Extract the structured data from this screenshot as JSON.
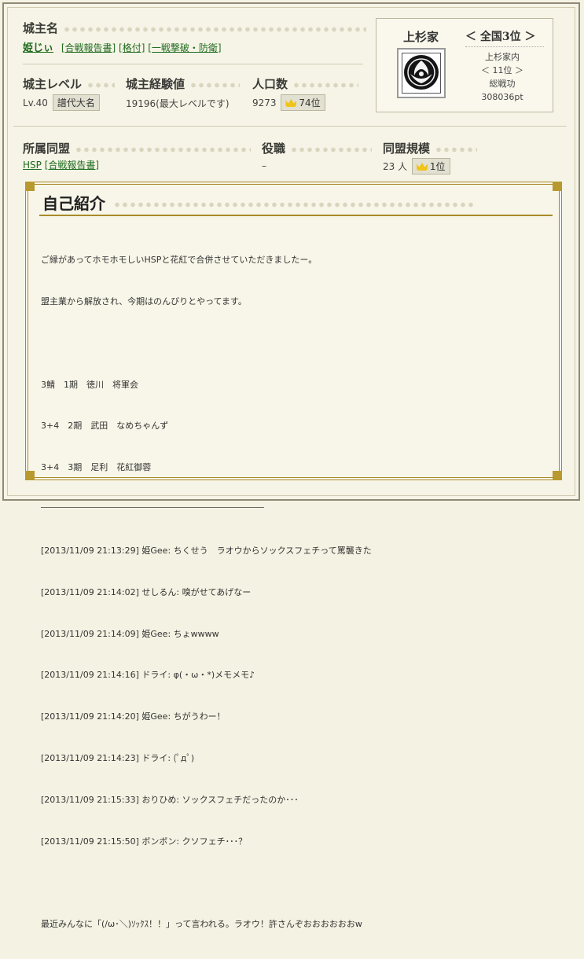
{
  "castle_lord": {
    "heading": "城主名",
    "name": "姫じぃ",
    "links": [
      "[合戦報告書]",
      "[格付]",
      "[一戦撃破・防衛]"
    ]
  },
  "level": {
    "heading": "城主レベル",
    "value": "Lv.40",
    "rank_name": "譜代大名"
  },
  "experience": {
    "heading": "城主経験値",
    "value": "19196(最大レベルです)"
  },
  "population": {
    "heading": "人口数",
    "value": "9273",
    "rank": "74位"
  },
  "clan": {
    "name": "上杉家",
    "national_rank": "＜ 全国3位 ＞",
    "within_label": "上杉家内",
    "within_rank": "＜ 11位 ＞",
    "merit_label": "総戦功",
    "merit_value": "308036pt"
  },
  "alliance": {
    "heading": "所属同盟",
    "name": "HSP",
    "link": "[合戦報告書]"
  },
  "role": {
    "heading": "役職",
    "value": "–"
  },
  "alliance_size": {
    "heading": "同盟規模",
    "members": "23 人",
    "rank": "1位"
  },
  "self_intro": {
    "title": "自己紹介",
    "lines": [
      "ご縁があってホモホモしいHSPと花紅で合併させていただきましたー。",
      "盟主業から解放され、今期はのんびりとやってます。",
      "",
      "3鯖　1期　徳川　将軍会",
      "3+4　2期　武田　なめちゃんず",
      "3+4　3期　足利　花紅御蓉"
    ],
    "chat_lines": [
      "[2013/11/09 21:13:29] 姫Gee: ちくせう　ラオウからソックスフェチって罵襲きた",
      "[2013/11/09 21:14:02] せしるん: 嗅がせてあげなー",
      "[2013/11/09 21:14:09] 姫Gee: ちょwwww",
      "[2013/11/09 21:14:16] ドライ: φ(・ω・*)メモメモ♪",
      "[2013/11/09 21:14:20] 姫Gee: ちがうわー！",
      "[2013/11/09 21:14:23] ドライ: (ﾟдﾟ)",
      "[2013/11/09 21:15:33] おりひめ: ソックスフェチだったのか･･･",
      "[2013/11/09 21:15:50] ボンボン: クソフェチ･･･？",
      "",
      "最近みんなに「(/ω･＼)ｿｯｸｽ！！」って言われる。ラオウ！許さんぞおおおおおおw"
    ]
  },
  "colors": {
    "accent_gold": "#a88a2a",
    "link_green": "#1f6b1f",
    "crown": "#f0c419"
  }
}
